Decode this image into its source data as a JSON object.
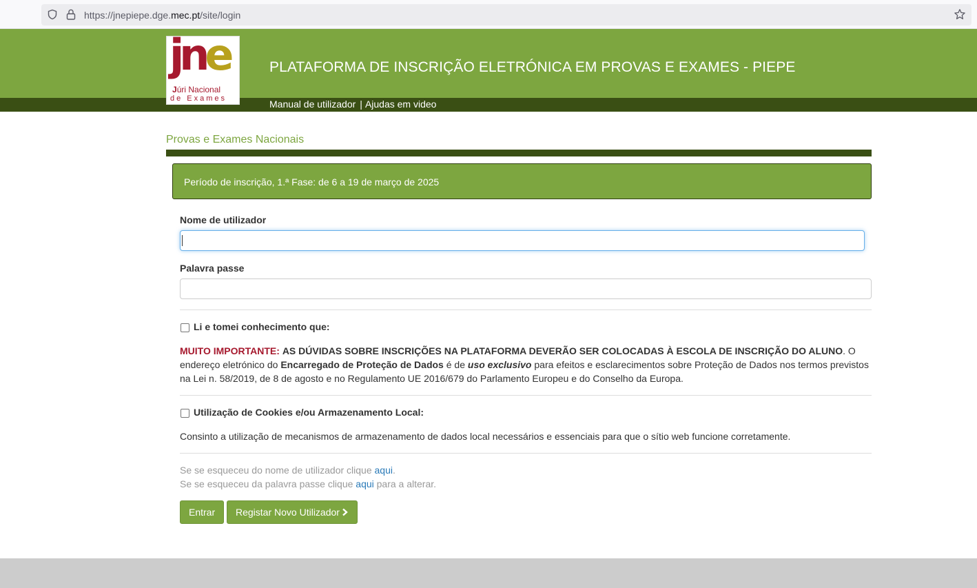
{
  "browser": {
    "url_prefix": "https://jnepiepe.dge.",
    "url_domain": "mec.pt",
    "url_suffix": "/site/login"
  },
  "header": {
    "logo_juri": "úri Nacional",
    "logo_juri_j": "J",
    "logo_exames": "de Exames",
    "title": "PLATAFORMA DE INSCRIÇÃO ELETRÓNICA EM PROVAS E EXAMES - PIEPE",
    "nav": {
      "manual": "Manual de utilizador",
      "separator": "|",
      "videos": "Ajudas em video"
    }
  },
  "main": {
    "section_title": "Provas e Exames Nacionais",
    "alert": "Período de inscrição, 1.ª Fase: de 6 a 19 de março de 2025",
    "username_label": "Nome de utilizador",
    "username_value": "",
    "password_label": "Palavra passe",
    "password_value": "",
    "ack_label": "Li e tomei conhecimento que:",
    "ack_checked": false,
    "important_prefix": "MUITO IMPORTANTE:",
    "important_caps": "AS DÚVIDAS SOBRE INSCRIÇÕES NA PLATAFORMA DEVERÃO SER COLOCADAS À ESCOLA DE INSCRIÇÃO DO ALUNO",
    "important_text1": ". O endereço eletrónico do ",
    "dpo": "Encarregado de Proteção de Dados",
    "important_text2": " é de ",
    "exclusive": "uso exclusivo",
    "important_text3": " para efeitos e esclarecimentos sobre Proteção de Dados nos termos previstos na Lei n. 58/2019, de 8 de agosto e no Regulamento UE 2016/679 do Parlamento Europeu e do Conselho da Europa.",
    "cookies_label": "Utilização de Cookies e/ou Armazenamento Local:",
    "cookies_checked": false,
    "cookies_text": "Consinto a utilização de mecanismos de armazenamento de dados local necessários e essenciais para que o sítio web funcione corretamente.",
    "forgot_user_prefix": "Se se esqueceu do nome de utilizador clique ",
    "forgot_user_link": "aqui",
    "forgot_user_suffix": ".",
    "forgot_pass_prefix": "Se se esqueceu da palavra passe clique ",
    "forgot_pass_link": "aqui",
    "forgot_pass_suffix": " para a alterar.",
    "login_button": "Entrar",
    "register_button": "Registar Novo Utilizador"
  },
  "colors": {
    "brand_green": "#7da640",
    "dark_green": "#3a4f14",
    "important_red": "#a6192e",
    "link_blue": "#2a7ab8"
  }
}
